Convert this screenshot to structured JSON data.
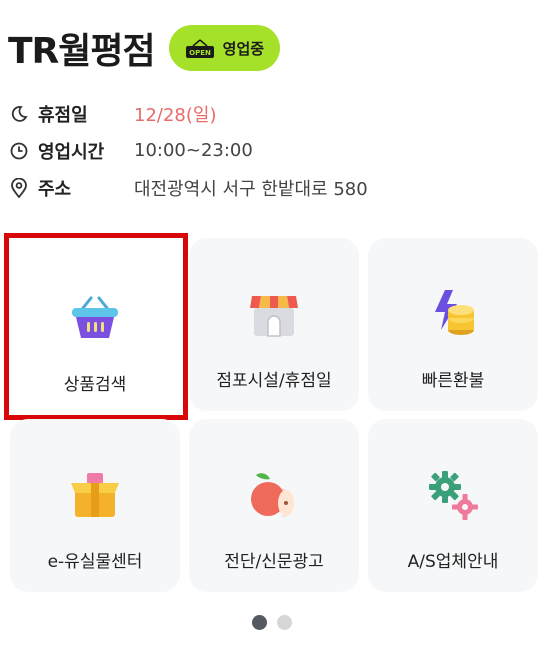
{
  "store": {
    "name": "TR월평점",
    "status_badge": {
      "icon_text": "OPEN",
      "label": "영업중",
      "color": "#a6e12a"
    }
  },
  "info": [
    {
      "icon": "moon-icon",
      "label": "휴점일",
      "value": "12/28(일)",
      "value_color": "#e86a6a"
    },
    {
      "icon": "clock-icon",
      "label": "영업시간",
      "value": "10:00~23:00"
    },
    {
      "icon": "location-pin-icon",
      "label": "주소",
      "value": "대전광역시 서구 한밭대로 580"
    }
  ],
  "menu": [
    {
      "icon": "shopping-basket-icon",
      "label": "상품검색",
      "selected": true
    },
    {
      "icon": "storefront-icon",
      "label": "점포시설/휴점일"
    },
    {
      "icon": "lightning-coin-icon",
      "label": "빠른환불"
    },
    {
      "icon": "box-icon",
      "label": "e-유실물센터"
    },
    {
      "icon": "apple-icon",
      "label": "전단/신문광고"
    },
    {
      "icon": "gears-icon",
      "label": "A/S업체안내"
    }
  ],
  "pagination": {
    "current": 1,
    "total": 2
  },
  "colors": {
    "highlight_border": "#d7070a",
    "card_bg": "#f6f7f9"
  }
}
